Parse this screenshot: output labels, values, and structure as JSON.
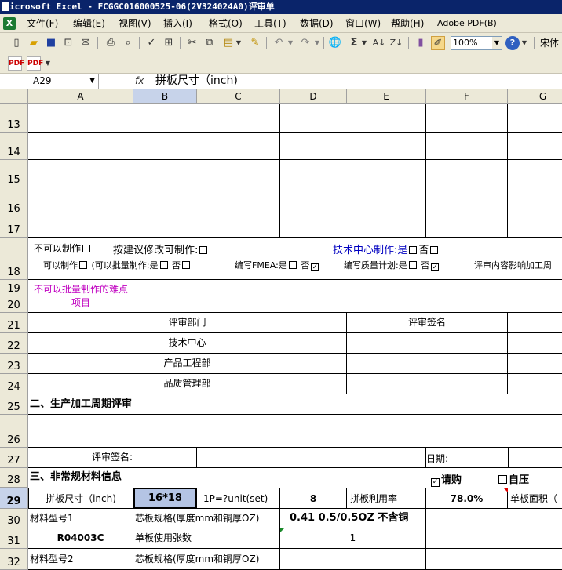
{
  "window": {
    "app_name": "Microsoft Excel",
    "title": "icrosoft Excel - FCGGC016000525-06(2V324024A0)评审单"
  },
  "menu": {
    "items": [
      "文件(F)",
      "编辑(E)",
      "视图(V)",
      "插入(I)",
      "格式(O)",
      "工具(T)",
      "数据(D)",
      "窗口(W)",
      "帮助(H)",
      "Adobe PDF(B)"
    ]
  },
  "toolbar": {
    "zoom": "100%",
    "font": "宋体"
  },
  "formula_bar": {
    "name_box": "A29",
    "fx": "fx",
    "value": "拼板尺寸（inch)"
  },
  "columns": [
    "A",
    "B",
    "C",
    "D",
    "E",
    "F",
    "G"
  ],
  "rows": [
    "13",
    "14",
    "15",
    "16",
    "17",
    "18",
    "19",
    "20",
    "21",
    "22",
    "23",
    "24",
    "25",
    "26",
    "27",
    "28",
    "29",
    "30",
    "31",
    "32"
  ],
  "sheet": {
    "r17_cannot_make": "不可以制作",
    "r17_modify": "按建议修改可制作:",
    "r17_tech_center": "技术中心制作:是",
    "r17_no": "否",
    "r18_can_make": "可以制作",
    "r18_batch": "(可以批量制作:是",
    "r18_no1": "否",
    "r18_fmea": "编写FMEA:是",
    "r18_no2": "否",
    "r18_quality": "编写质量计划:是",
    "r18_no3": "否",
    "r18_review": "评审内容影响加工周",
    "r19_difficult": "不可以批量制作的难点项目",
    "r21_dept": "评审部门",
    "r21_sign": "评审签名",
    "r22_tech": "技术中心",
    "r23_pe": "产品工程部",
    "r24_qa": "品质管理部",
    "r25_section": "二、生产加工周期评审",
    "r27_sign": "评审签名:",
    "r27_date": "日期:",
    "r28_section": "三、非常规材料信息",
    "r28_purchase": "请购",
    "r28_self": "自压",
    "r29_panel_size": "拼板尺寸（inch)",
    "r29_panel_value": "16*18",
    "r29_unit": "1P=?unit(set)",
    "r29_unit_value": "8",
    "r29_util": "拼板利用率",
    "r29_util_value": "78.0%",
    "r29_area": "单板面积（",
    "r30_mat1": "材料型号1",
    "r30_core": "芯板规格(厚度mm和铜厚OZ)",
    "r30_core_value": "0.41 0.5/0.5OZ 不含铜",
    "r31_mat_value": "R04003C",
    "r31_sheets": "单板使用张数",
    "r31_sheets_value": "1",
    "r32_mat2": "材料型号2",
    "r32_core": "芯板规格(厚度mm和铜厚OZ)"
  }
}
